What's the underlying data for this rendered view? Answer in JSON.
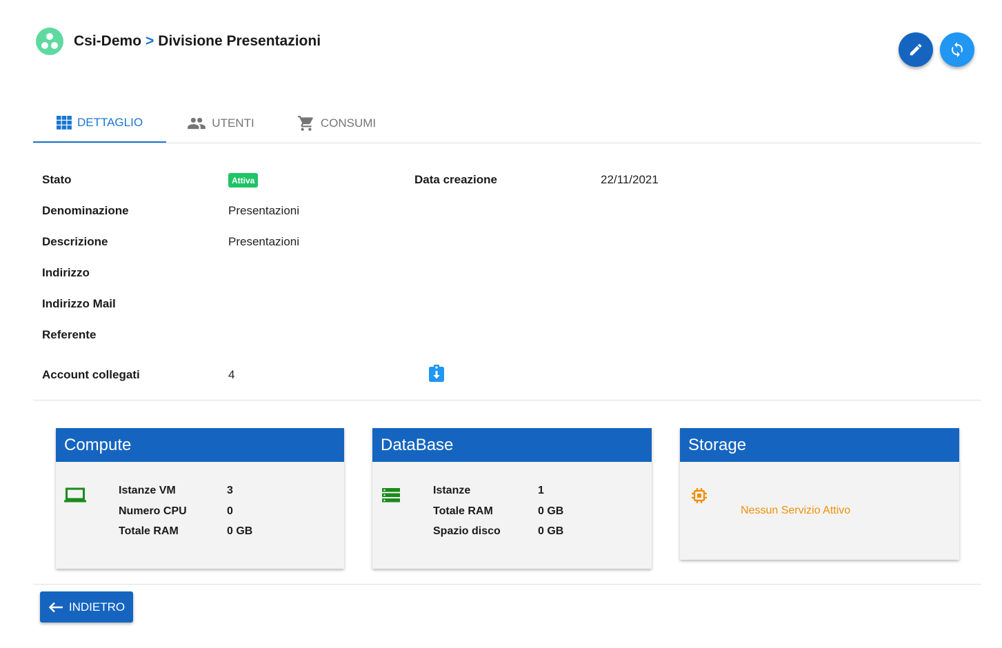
{
  "header": {
    "breadcrumb_parent": "Csi-Demo",
    "separator": ">",
    "breadcrumb_current": "Divisione Presentazioni"
  },
  "actions": {
    "edit_icon": "pencil-icon",
    "refresh_icon": "sync-icon"
  },
  "tabs": [
    {
      "label": "DETTAGLIO",
      "icon": "grid-icon",
      "active": true
    },
    {
      "label": "UTENTI",
      "icon": "people-icon",
      "active": false
    },
    {
      "label": "CONSUMI",
      "icon": "cart-icon",
      "active": false
    }
  ],
  "details": {
    "stato_label": "Stato",
    "stato_value": "Attiva",
    "data_creazione_label": "Data creazione",
    "data_creazione_value": "22/11/2021",
    "denominazione_label": "Denominazione",
    "denominazione_value": "Presentazioni",
    "descrizione_label": "Descrizione",
    "descrizione_value": "Presentazioni",
    "indirizzo_label": "Indirizzo",
    "indirizzo_mail_label": "Indirizzo Mail",
    "referente_label": "Referente",
    "account_label": "Account collegati",
    "account_value": "4"
  },
  "cards": {
    "compute": {
      "title": "Compute",
      "icon": "laptop-icon",
      "stats": [
        {
          "label": "Istanze VM",
          "value": "3"
        },
        {
          "label": "Numero CPU",
          "value": "0"
        },
        {
          "label": "Totale RAM",
          "value": "0 GB"
        }
      ]
    },
    "database": {
      "title": "DataBase",
      "icon": "database-icon",
      "stats": [
        {
          "label": "Istanze",
          "value": "1"
        },
        {
          "label": "Totale RAM",
          "value": "0 GB"
        },
        {
          "label": "Spazio disco",
          "value": "0 GB"
        }
      ]
    },
    "storage": {
      "title": "Storage",
      "icon": "chip-icon",
      "empty_text": "Nessun Servizio Attivo"
    }
  },
  "footer": {
    "back_label": "INDIETRO"
  },
  "colors": {
    "primary": "#1565c0",
    "accent": "#2196f3",
    "success": "#1ec466",
    "compute_icon": "#1b8a1b",
    "database_icon": "#1b8a1b",
    "storage_icon": "#f0900a",
    "logo": "#5fd9a0"
  }
}
